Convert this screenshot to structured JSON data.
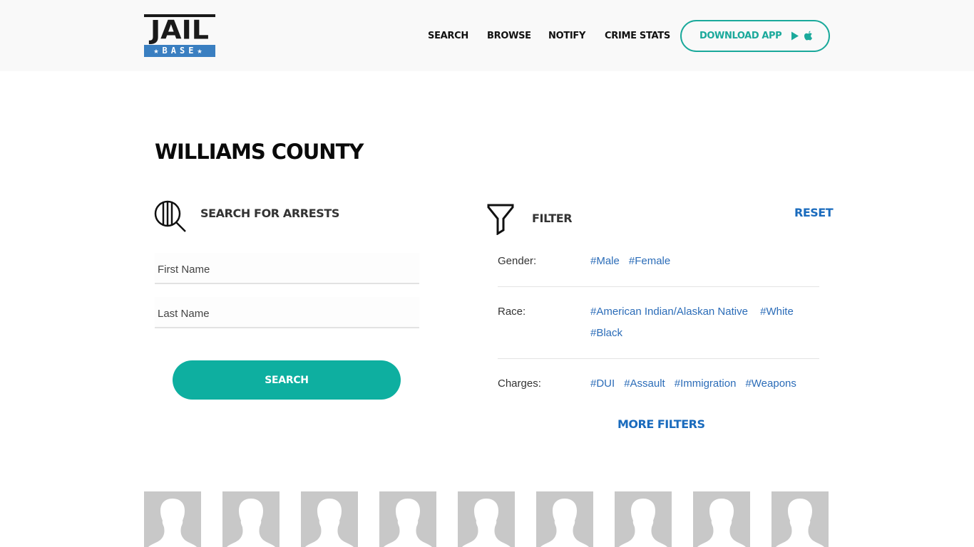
{
  "header": {
    "logo": {
      "top_text": "JAIL",
      "bottom_text": "★BASE★",
      "bar_color": "#3a7fc1"
    },
    "nav": [
      {
        "label": "SEARCH"
      },
      {
        "label": "BROWSE"
      },
      {
        "label": "NOTIFY"
      },
      {
        "label": "CRIME STATS"
      }
    ],
    "download_button": {
      "label": "DOWNLOAD APP",
      "icons": [
        "google-play-icon",
        "apple-icon"
      ],
      "color": "#1aa99b"
    }
  },
  "page": {
    "title": "WILLIAMS COUNTY"
  },
  "search": {
    "title": "SEARCH FOR ARRESTS",
    "icon": "magnifier-bars-icon",
    "first_name": {
      "value": "",
      "placeholder": "First Name"
    },
    "last_name": {
      "value": "",
      "placeholder": "Last Name"
    },
    "button_label": "SEARCH",
    "button_color": "#0eafa0"
  },
  "filter": {
    "title": "FILTER",
    "icon": "funnel-icon",
    "reset_label": "RESET",
    "link_color": "#1a6bbd",
    "rows": [
      {
        "label": "Gender:",
        "tags": [
          "#Male",
          "#Female"
        ]
      },
      {
        "label": "Race:",
        "tags": [
          "#American Indian/Alaskan Native",
          "#White",
          "#Black"
        ]
      },
      {
        "label": "Charges:",
        "tags": [
          "#DUI",
          "#Assault",
          "#Immigration",
          "#Weapons"
        ]
      }
    ],
    "more_filters_label": "MORE FILTERS"
  },
  "mugshots": {
    "count_visible": 9,
    "placeholder": "person-silhouette-icon"
  }
}
